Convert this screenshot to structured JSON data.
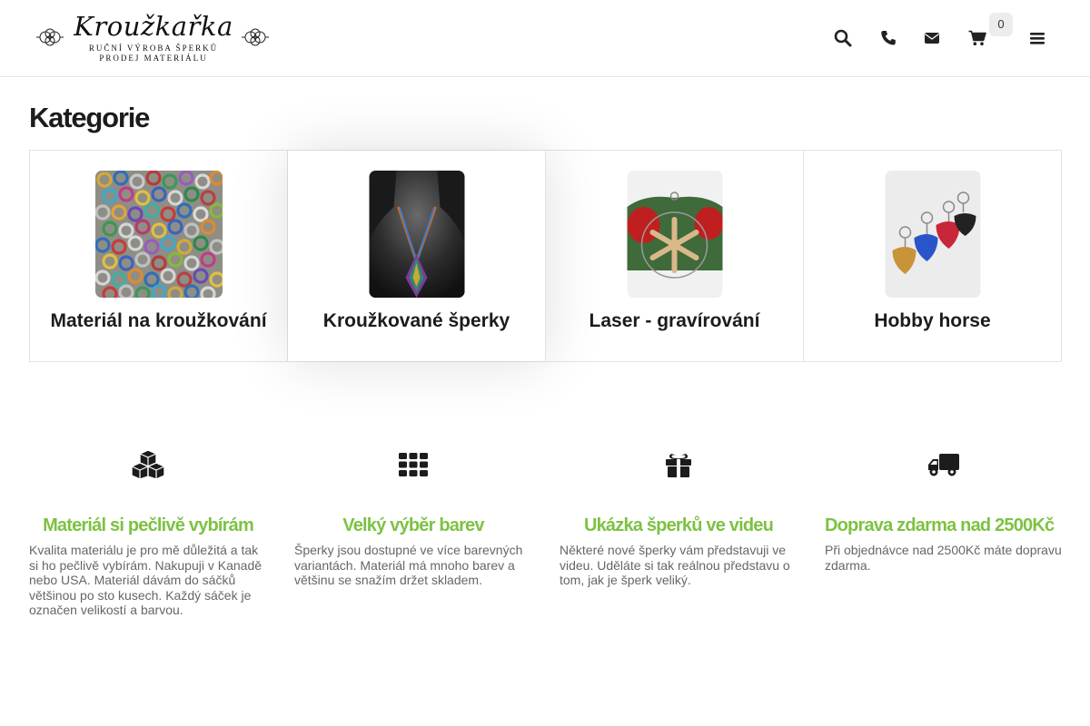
{
  "header": {
    "logo": {
      "title": "Kroužkařka",
      "line1": "RUČNÍ VÝROBA ŠPERKŮ",
      "line2": "PRODEJ MATERIÁLU"
    },
    "icons": [
      "search-icon",
      "phone-icon",
      "envelope-icon",
      "cart-icon",
      "menu-icon"
    ],
    "cart_count": "0"
  },
  "categories": {
    "title": "Kategorie",
    "items": [
      {
        "label": "Materiál na kroužkování",
        "image": "colorful-rings-photo"
      },
      {
        "label": "Kroužkované šperky",
        "image": "chainmail-pendant-photo"
      },
      {
        "label": "Laser - gravírování",
        "image": "wooden-snowflake-ornament-photo"
      },
      {
        "label": "Hobby horse",
        "image": "guitar-pick-keychains-photo"
      }
    ]
  },
  "features": [
    {
      "icon": "cubes-icon",
      "title": "Materiál si pečlivě vybírám",
      "text": "Kvalita materiálu je pro mě důležitá a tak si ho pečlivě vybírám. Nakupuji v Kanadě nebo USA. Materiál dávám do sáčků většinou po sto kusech. Každý sáček je označen velikostí a barvou."
    },
    {
      "icon": "grid-icon",
      "title": "Velký výběr barev",
      "text": "Šperky jsou dostupné ve více barevných variantách. Materiál má mnoho barev a většinu se snažím držet skladem."
    },
    {
      "icon": "gift-icon",
      "title": "Ukázka šperků ve videu",
      "text": "Některé nové šperky vám představuji ve videu. Uděláte si tak reálnou představu o tom, jak je šperk veliký."
    },
    {
      "icon": "truck-icon",
      "title": "Doprava zdarma nad 2500Kč",
      "text": "Při objednávce nad 2500Kč máte dopravu zdarma."
    }
  ],
  "colors": {
    "accent_green": "#7dc242",
    "text_dark": "#1c1c1c",
    "text_muted": "#666666",
    "border": "#e3e3e3"
  }
}
